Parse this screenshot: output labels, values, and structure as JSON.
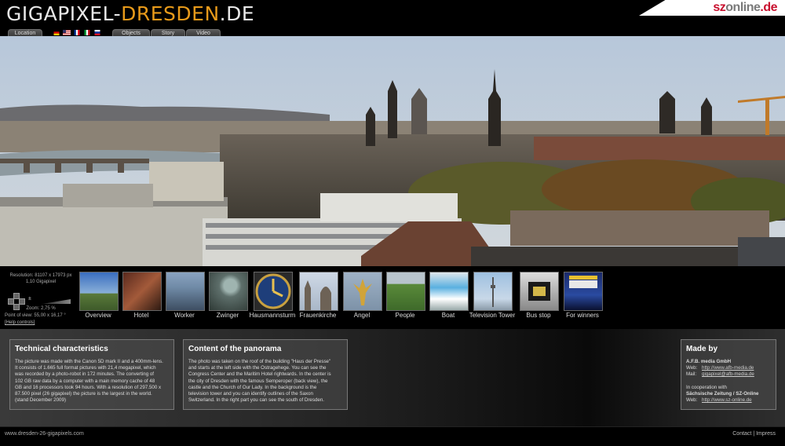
{
  "header": {
    "logo_part1": "GIGAPIXEL-",
    "logo_part2": "DRESDEN",
    "logo_part3": ".DE",
    "tabs": [
      "Location",
      "Objects",
      "Story",
      "Video"
    ],
    "flags": [
      "germany-flag",
      "usa-flag",
      "france-flag",
      "italy-flag",
      "russia-flag"
    ],
    "partner_part1": "sz",
    "partner_part2": "online",
    "partner_part3": ".de"
  },
  "controls": {
    "resolution": "Resolution: 81107 x 17973 px",
    "gigapixel": "1,10 Gigapixel",
    "zoom": "Zoom: 2,75 %",
    "point_of_view": "Point of view: 55,00 x 16,17 °",
    "help_link": "[Help controls]"
  },
  "thumbnails": [
    {
      "label": "Overview",
      "icon": "overview-thumb"
    },
    {
      "label": "Hotel",
      "icon": "hotel-thumb"
    },
    {
      "label": "Worker",
      "icon": "worker-thumb"
    },
    {
      "label": "Zwinger",
      "icon": "zwinger-thumb"
    },
    {
      "label": "Hausmannsturm",
      "icon": "clock-thumb"
    },
    {
      "label": "Frauenkirche",
      "icon": "church-thumb"
    },
    {
      "label": "Angel",
      "icon": "angel-thumb"
    },
    {
      "label": "People",
      "icon": "people-thumb"
    },
    {
      "label": "Boat",
      "icon": "boat-thumb"
    },
    {
      "label": "Television Tower",
      "icon": "tower-thumb"
    },
    {
      "label": "Bus stop",
      "icon": "busstop-thumb"
    },
    {
      "label": "For winners",
      "icon": "winners-thumb"
    }
  ],
  "technical": {
    "title": "Technical characteristics",
    "lines": [
      "The picture was made with the Canon 5D mark II and a 400mm-lens.",
      "It consists of 1.665 full format pictures with 21,4 megapixel, which",
      "was recorded by a photo-robot in 172 minutes. The converting of",
      "102 GB raw data by a computer with a main memory cache of 48",
      "GB and 16 processors took 94 hours. With a resolution of 297.500 x",
      "87.500 pixel (26 gigapixel) the picture is the largest in the world.",
      "(stand December 2009)"
    ]
  },
  "content": {
    "title": "Content of the panorama",
    "lines": [
      "The photo was taken on the roof of the building \"Haus der Presse\"",
      "and starts at the left side with the Ostragehege. You can see the",
      "Congress Center and the Maritim Hotel rightwards. In the center is",
      "the city of Dresden with the famous Semperoper (back view), the",
      "castle and the Church of Our Lady. In the background is the",
      "television tower and you can identify outlines of the Saxon",
      "Switzerland. In the right part you can see the south of Dresden."
    ]
  },
  "madeby": {
    "title": "Made by",
    "company": "A.F.B. media GmbH",
    "web_label": "Web:",
    "web_url": "http://www.afb-media.de",
    "mail_label": "Mail:",
    "mail": "gigapixel@afb-media.de",
    "coop": "In cooperation with",
    "coop_name": "Sächsische Zeitung / SZ-Online",
    "web2_label": "Web:",
    "web2_url": "http://www.sz-online.de"
  },
  "footer": {
    "url": "www.dresden-26-gigapixels.com",
    "contact": "Contact",
    "sep": " | ",
    "impress": "Impress"
  }
}
